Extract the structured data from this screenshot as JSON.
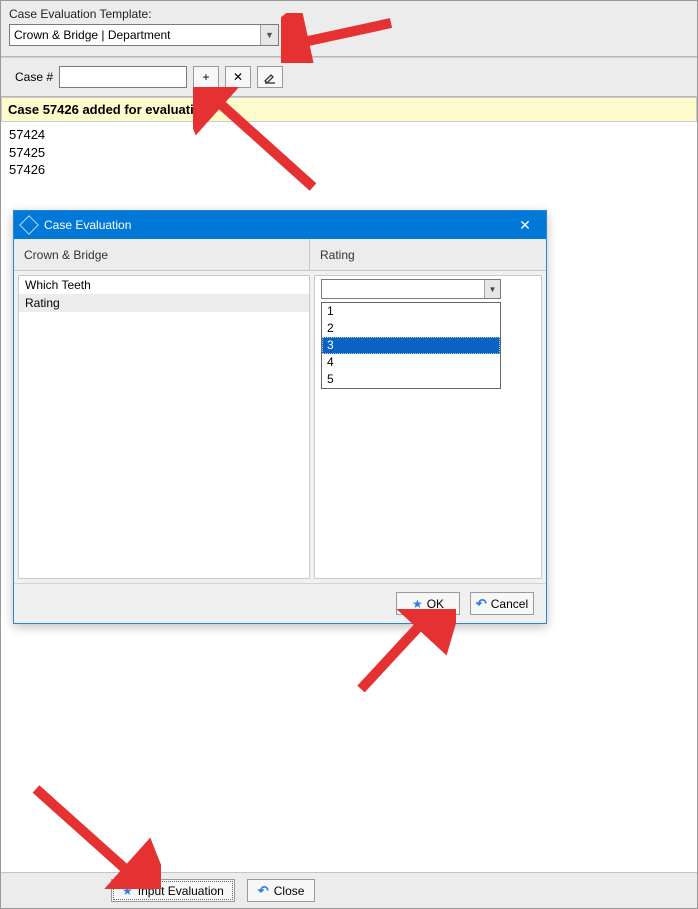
{
  "top": {
    "template_label": "Case Evaluation Template:",
    "template_value": "Crown & Bridge | Department"
  },
  "case_row": {
    "label": "Case #",
    "input_value": "",
    "add_label": "+",
    "remove_label": "✕",
    "clear_label": "✎"
  },
  "highlight": "Case 57426 added for evaluation",
  "cases": [
    "57424",
    "57425",
    "57426"
  ],
  "dialog": {
    "title": "Case Evaluation",
    "left_header": "Crown & Bridge",
    "right_header": "Rating",
    "items": [
      "Which Teeth",
      "Rating"
    ],
    "selected_item_index": 1,
    "rating_value": "",
    "rating_options": [
      "1",
      "2",
      "3",
      "4",
      "5"
    ],
    "rating_selected_index": 2,
    "ok_label": "OK",
    "cancel_label": "Cancel"
  },
  "bottom": {
    "input_eval_label": "Input Evaluation",
    "close_label": "Close"
  }
}
